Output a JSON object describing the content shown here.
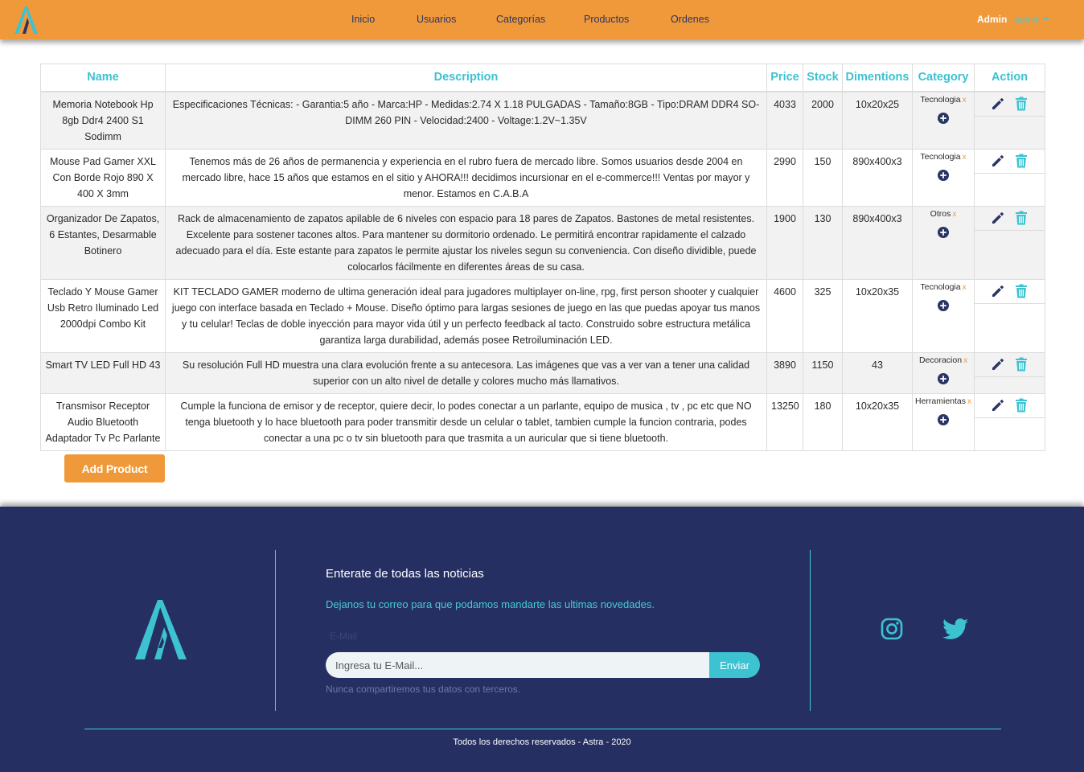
{
  "nav": {
    "links": [
      "Inicio",
      "Usuarios",
      "Categorías",
      "Productos",
      "Ordenes"
    ],
    "role": "Admin",
    "user": "admin"
  },
  "table": {
    "headers": [
      "Name",
      "Description",
      "Price",
      "Stock",
      "Dimentions",
      "Category",
      "Action"
    ],
    "rows": [
      {
        "name": "Memoria Notebook Hp 8gb Ddr4 2400 S1 Sodimm",
        "description": "Especificaciones Técnicas: - Garantia:5 año - Marca:HP - Medidas:2.74 X 1.18 PULGADAS - Tamaño:8GB - Tipo:DRAM DDR4 SO-DIMM 260 PIN - Velocidad:2400 - Voltage:1.2V~1.35V",
        "price": "4033",
        "stock": "2000",
        "dimensions": "10x20x25",
        "category": "Tecnologia",
        "remove": "x"
      },
      {
        "name": "Mouse Pad Gamer XXL Con Borde Rojo 890 X 400 X 3mm",
        "description": "Tenemos más de 26 años de permanencia y experiencia en el rubro fuera de mercado libre. Somos usuarios desde 2004 en mercado libre, hace 15 años que estamos en el sitio y AHORA!!! decidimos incursionar en el e-commerce!!! Ventas por mayor y menor. Estamos en C.A.B.A",
        "price": "2990",
        "stock": "150",
        "dimensions": "890x400x3",
        "category": "Tecnologia",
        "remove": "x"
      },
      {
        "name": "Organizador De Zapatos, 6 Estantes, Desarmable Botinero",
        "description": "Rack de almacenamiento de zapatos apilable de 6 niveles con espacio para 18 pares de Zapatos. Bastones de metal resistentes. Excelente para sostener tacones altos. Para mantener su dormitorio ordenado. Le permitirá encontrar rapidamente el calzado adecuado para el día. Este estante para zapatos le permite ajustar los niveles segun su conveniencia. Con diseño dividible, puede colocarlos fácilmente en diferentes áreas de su casa.",
        "price": "1900",
        "stock": "130",
        "dimensions": "890x400x3",
        "category": "Otros",
        "remove": "x"
      },
      {
        "name": "Teclado Y Mouse Gamer Usb Retro Iluminado Led 2000dpi Combo Kit",
        "description": "KIT TECLADO GAMER moderno de ultima generación ideal para jugadores multiplayer on-line, rpg, first person shooter y cualquier juego con interface basada en Teclado + Mouse. Diseño óptimo para largas sesiones de juego en las que puedas apoyar tus manos y tu celular! Teclas de doble inyección para mayor vida útil y un perfecto feedback al tacto. Construido sobre estructura metálica garantiza larga durabilidad, además posee Retroiluminación LED.",
        "price": "4600",
        "stock": "325",
        "dimensions": "10x20x35",
        "category": "Tecnologia",
        "remove": "x"
      },
      {
        "name": "Smart TV LED Full HD 43",
        "description": "Su resolución Full HD muestra una clara evolución frente a su antecesora. Las imágenes que vas a ver van a tener una calidad superior con un alto nivel de detalle y colores mucho más llamativos.",
        "price": "3890",
        "stock": "1150",
        "dimensions": "43",
        "category": "Decoracion",
        "remove": "x"
      },
      {
        "name": "Transmisor Receptor Audio Bluetooth Adaptador Tv Pc Parlante",
        "description": "Cumple la funciona de emisor y de receptor, quiere decir, lo podes conectar a un parlante, equipo de musica , tv , pc etc que NO tenga bluetooth y lo hace bluetooth para poder transmitir desde un celular o tablet, tambien cumple la funcion contraria, podes conectar a una pc o tv sin bluetooth para que trasmita a un auricular que si tiene bluetooth.",
        "price": "13250",
        "stock": "180",
        "dimensions": "10x20x35",
        "category": "Herramientas",
        "remove": "x"
      }
    ]
  },
  "add_button": "Add Product",
  "footer": {
    "title": "Enterate de todas las noticias",
    "subtitle": "Dejanos tu correo para que podamos mandarte las ultimas novedades.",
    "email_label": "E-Mail",
    "email_placeholder": "Ingresa tu E-Mail...",
    "send_label": "Enviar",
    "note": "Nunca compartiremos tus datos con terceros.",
    "copyright": "Todos los derechos reservados - Astra - 2020"
  },
  "colors": {
    "navbar": "#f0993a",
    "accent": "#3cc2d1",
    "footer": "#252f62",
    "icon_dark": "#2a3566"
  },
  "icons": [
    "astra-logo-icon",
    "pencil-icon",
    "trash-icon",
    "plus-circle-icon",
    "instagram-icon",
    "twitter-icon"
  ]
}
